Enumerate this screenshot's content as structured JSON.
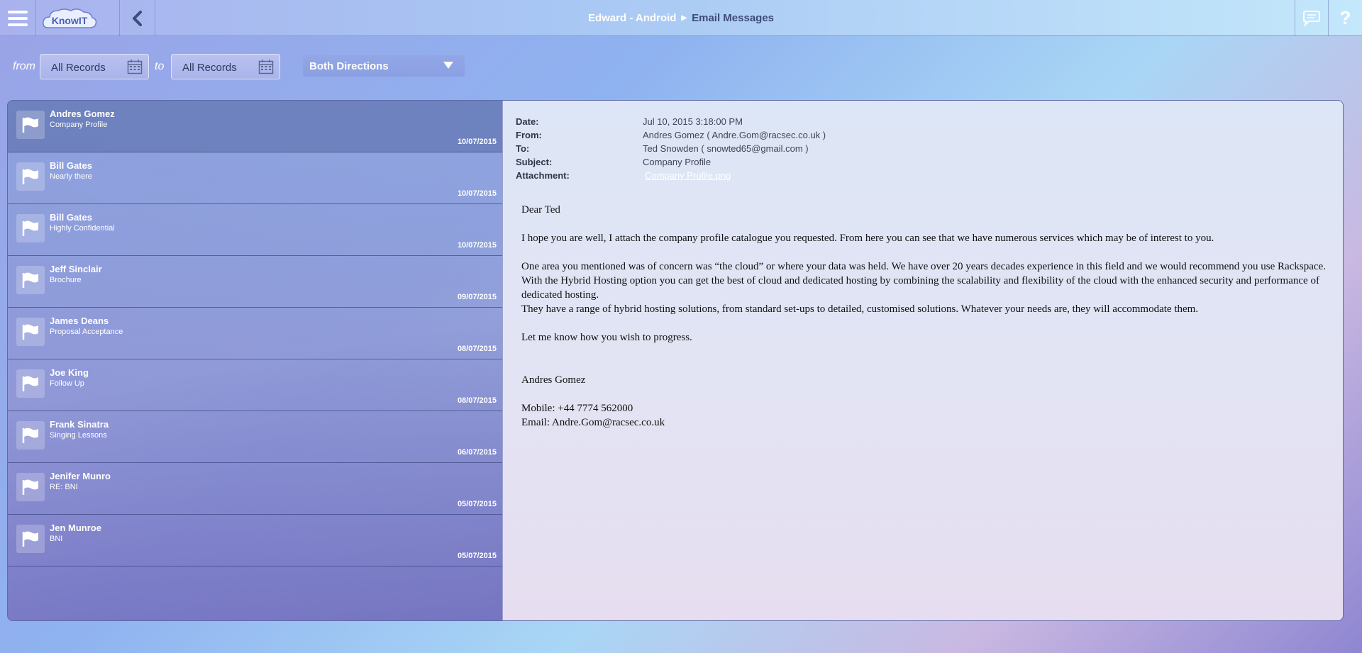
{
  "topbar": {
    "logo_text": "KnowIT",
    "breadcrumb_parent": "Edward - Android",
    "breadcrumb_current": "Email Messages",
    "help_label": "?"
  },
  "filters": {
    "from_label": "from",
    "from_value": "All Records",
    "to_label": "to",
    "to_value": "All Records",
    "direction_value": "Both Directions"
  },
  "messages": [
    {
      "sender": "Andres Gomez",
      "subject": "Company Profile",
      "date": "10/07/2015"
    },
    {
      "sender": "Bill Gates",
      "subject": "Nearly there",
      "date": "10/07/2015"
    },
    {
      "sender": "Bill Gates",
      "subject": "Highly Confidential",
      "date": "10/07/2015"
    },
    {
      "sender": "Jeff Sinclair",
      "subject": "Brochure",
      "date": "09/07/2015"
    },
    {
      "sender": "James Deans",
      "subject": "Proposal Acceptance",
      "date": "08/07/2015"
    },
    {
      "sender": "Joe King",
      "subject": "Follow Up",
      "date": "08/07/2015"
    },
    {
      "sender": "Frank Sinatra",
      "subject": "Singing Lessons",
      "date": "06/07/2015"
    },
    {
      "sender": "Jenifer Munro",
      "subject": "RE: BNI",
      "date": "05/07/2015"
    },
    {
      "sender": "Jen Munroe",
      "subject": "BNI",
      "date": "05/07/2015"
    }
  ],
  "detail": {
    "date_label": "Date:",
    "date_value": "Jul 10, 2015 3:18:00 PM",
    "from_label": "From:",
    "from_value": "Andres Gomez ( Andre.Gom@racsec.co.uk )",
    "to_label": "To:",
    "to_value": "Ted Snowden ( snowted65@gmail.com )",
    "subject_label": "Subject:",
    "subject_value": "Company Profile",
    "attachment_label": "Attachment:",
    "attachment_value": "Company Profile.png",
    "body": {
      "greeting": "Dear Ted",
      "p1": "I hope you are well, I attach the company profile catalogue you requested. From here you can see that we have numerous services which may be of interest to you.",
      "p2": "One area you mentioned was of concern was “the cloud” or where your data was held. We have over 20 years decades experience in this field and we would recommend you use Rackspace. With the Hybrid Hosting option you can get the best of cloud and dedicated hosting by combining the scalability and flexibility of the cloud with the enhanced security and performance of dedicated hosting.",
      "p3": "They have a range of hybrid hosting solutions, from standard set-ups to detailed, customised solutions. Whatever your needs are, they will accommodate them.",
      "p4": "Let me know how you wish to progress.",
      "signature": "Andres Gomez",
      "mobile": "Mobile: +44 7774 562000",
      "email": "Email: Andre.Gom@racsec.co.uk"
    }
  }
}
